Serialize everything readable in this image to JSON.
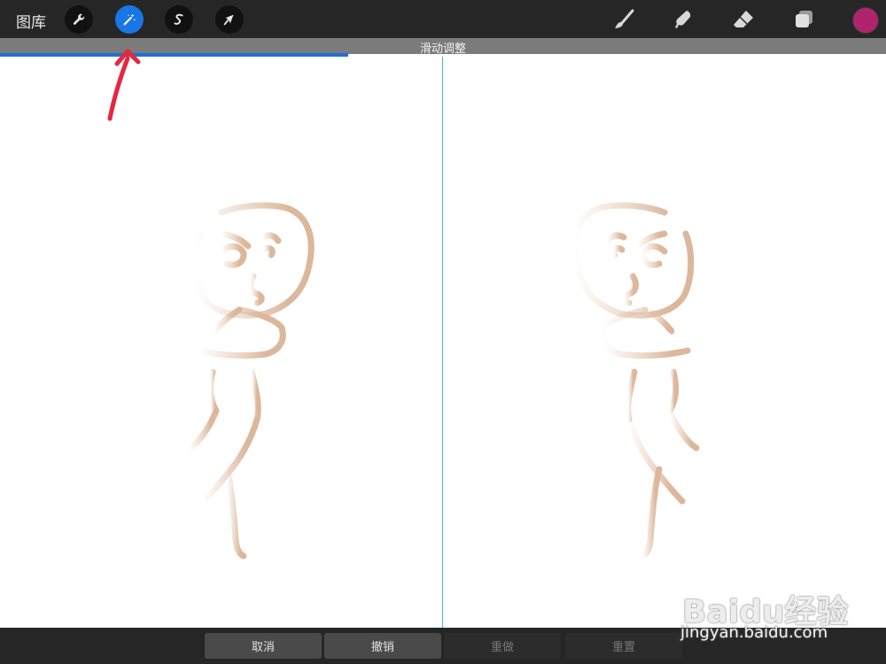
{
  "topbar": {
    "gallery_label": "图库",
    "tools": [
      {
        "name": "actions",
        "icon": "wrench-icon"
      },
      {
        "name": "adjustments",
        "icon": "magic-wand-icon",
        "active": true
      },
      {
        "name": "selection",
        "icon": "selection-s-icon"
      },
      {
        "name": "transform",
        "icon": "arrow-cursor-icon"
      }
    ],
    "right_tools": [
      {
        "name": "brush",
        "icon": "brush-icon"
      },
      {
        "name": "smudge",
        "icon": "smudge-icon"
      },
      {
        "name": "eraser",
        "icon": "eraser-icon"
      },
      {
        "name": "layers",
        "icon": "layers-icon"
      }
    ],
    "current_color": "#b0246e"
  },
  "adjust": {
    "label": "滑动调整",
    "slider_value": 0.393
  },
  "bottombar": {
    "cancel": "取消",
    "undo": "撤销",
    "redo": "重做",
    "reset": "重置"
  },
  "watermark": {
    "logo": "Baidu经验",
    "url": "jingyan.baidu.com"
  },
  "colors": {
    "accent": "#1976e6",
    "stroke": "#dcb79b",
    "annotation_arrow": "#e8263f"
  }
}
